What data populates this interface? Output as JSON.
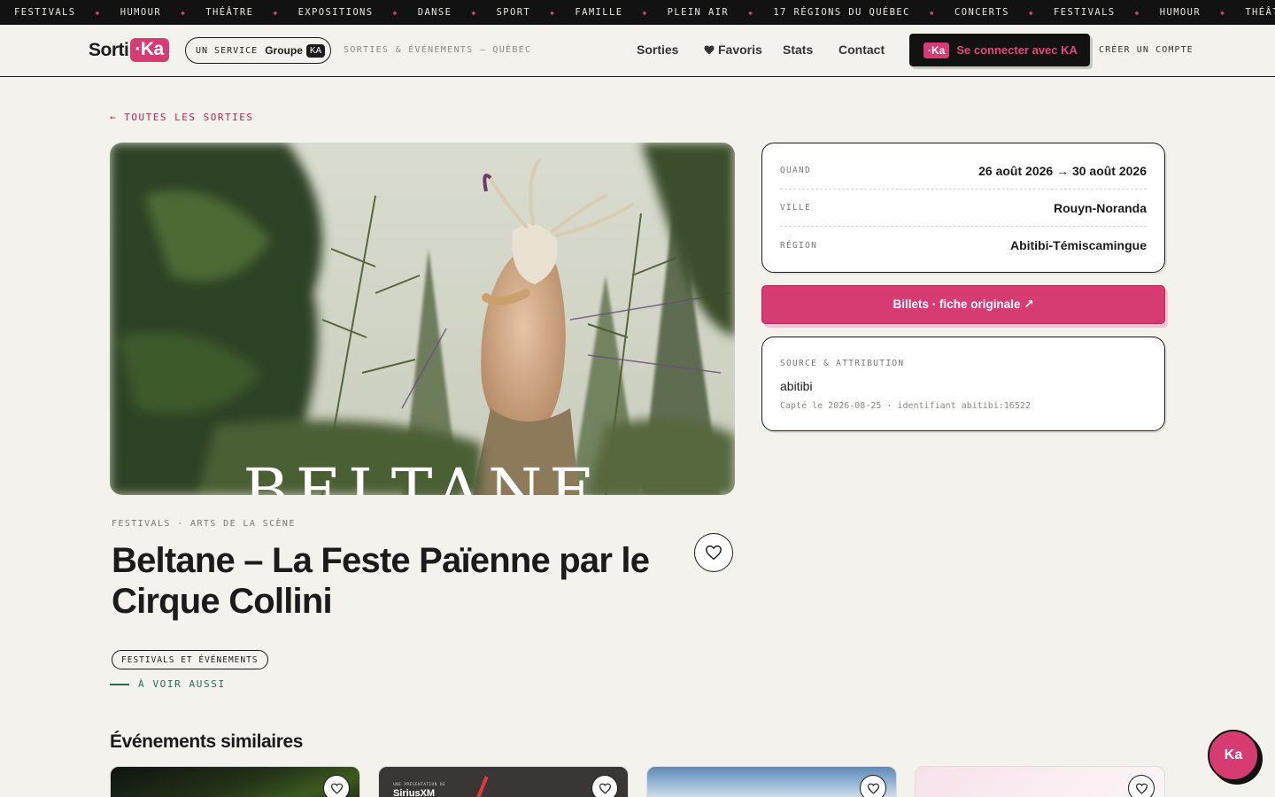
{
  "ticker": {
    "items": [
      "FESTIVALS",
      "HUMOUR",
      "THÉÂTRE",
      "EXPOSITIONS",
      "DANSE",
      "SPORT",
      "FAMILLE",
      "PLEIN AIR",
      "17 RÉGIONS DU QUÉBEC",
      "CONCERTS",
      "FESTIVALS",
      "HUMOUR",
      "THÉÂTRE"
    ],
    "separator": "◆"
  },
  "header": {
    "logo_text": "Sorti",
    "logo_ka": "·Ka",
    "service_prefix": "UN SERVICE",
    "service_group": "Groupe",
    "service_badge": "KA",
    "tagline": "SORTIES & ÉVÉNEMENTS — QUÉBEC",
    "nav": {
      "sorties": "Sorties",
      "favoris": "Favoris",
      "stats": "Stats",
      "contact": "Contact"
    },
    "login_badge": "·Ka",
    "login_label": "Se connecter avec KA",
    "create_account": "CRÉER UN COMPTE"
  },
  "back_link": "← TOUTES LES SORTIES",
  "hero": {
    "overlay_text": "BELTANE"
  },
  "event": {
    "categories": "FESTIVALS · ARTS DE LA SCÈNE",
    "title": "Beltane – La Feste Païenne par le Cirque Collini",
    "tag": "FESTIVALS ET ÉVÉNEMENTS",
    "see_also": "À VOIR AUSSI"
  },
  "info": {
    "rows": [
      {
        "key": "QUAND",
        "value": "26 août 2026 → 30 août 2026"
      },
      {
        "key": "VILLE",
        "value": "Rouyn-Noranda"
      },
      {
        "key": "RÉGION",
        "value": "Abitibi-Témiscamingue"
      }
    ]
  },
  "tickets_label": "Billets · fiche originale ↗",
  "source": {
    "heading": "SOURCE & ATTRIBUTION",
    "name": "abitibi",
    "caption": "Capté le 2026-08-25 · identifiant abitibi:16522"
  },
  "similar": {
    "heading": "Événements similaires",
    "card2_subtitle": "UNE PRÉSENTATION DE",
    "card2_brand": "SiriusXM"
  },
  "fab_label": "Ka",
  "colors": {
    "accent": "#d63c72",
    "ink": "#1b1b1b",
    "background": "#f4f2ed",
    "green": "#2b6b4f"
  },
  "icons": {
    "favoris": "heart-icon",
    "favorite_button": "heart-outline-icon"
  }
}
